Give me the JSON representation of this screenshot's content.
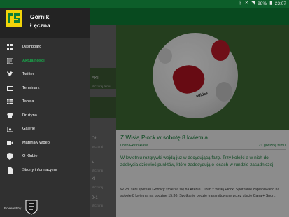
{
  "status_bar": {
    "battery": "98%",
    "time": "23:07",
    "icons": [
      "bluetooth-icon",
      "mute-icon",
      "wifi-icon",
      "battery-icon"
    ]
  },
  "drawer": {
    "club_name_line1": "Górnik",
    "club_name_line2": "Łęczna",
    "items": [
      {
        "label": "Dashboard",
        "icon": "dashboard-icon",
        "active": false
      },
      {
        "label": "Aktualności",
        "icon": "news-icon",
        "active": true
      },
      {
        "label": "Twitter",
        "icon": "twitter-icon",
        "active": false
      },
      {
        "label": "Terminarz",
        "icon": "calendar-icon",
        "active": false
      },
      {
        "label": "Tabela",
        "icon": "table-icon",
        "active": false
      },
      {
        "label": "Drużyna",
        "icon": "jersey-icon",
        "active": false
      },
      {
        "label": "Galerie",
        "icon": "camera-icon",
        "active": false
      },
      {
        "label": "Materiały wideo",
        "icon": "video-icon",
        "active": false
      },
      {
        "label": "O Klubie",
        "icon": "info-icon",
        "active": false
      },
      {
        "label": "Strony informacyjne",
        "icon": "document-icon",
        "active": false
      }
    ],
    "powered_by": "Powered by"
  },
  "list": {
    "items": [
      {
        "label": "AKI",
        "meta": "Wczoraj temu"
      },
      {
        "label": "Ob",
        "meta": "Wczoraj"
      },
      {
        "label": "Ł",
        "meta": "Wczoraj"
      },
      {
        "label": "Kl",
        "meta": "Wczoraj"
      },
      {
        "label": "0-1",
        "meta": "Wczoraj"
      }
    ]
  },
  "article": {
    "title": "Z Wisłą Płock w sobotę 8 kwietnia",
    "author": "Lotto Ekstraklasa",
    "time_ago": "21 godzinę temu",
    "ball_brand": "adidas",
    "lead": "W kwietniu rozgrywki wejdą już w decydującą fazę. Trzy kolejki a w nich do zdobycia dziewięć punktów, które zadecydują o losach w rundzie zasadniczej.",
    "body": "W 28. serii spotkań Górnicy zmierzą się na Arenie Lublin z Wisłą Płock. Spotkanie zaplanowano na sobotę 8 kwietnia na godzinę 15:30. Spotkanie będzie transmitowane przez stację Canal+ Sport."
  },
  "colors": {
    "brand_green": "#0e8036",
    "accent_green": "#18a84a",
    "drawer_bg": "#303030"
  }
}
